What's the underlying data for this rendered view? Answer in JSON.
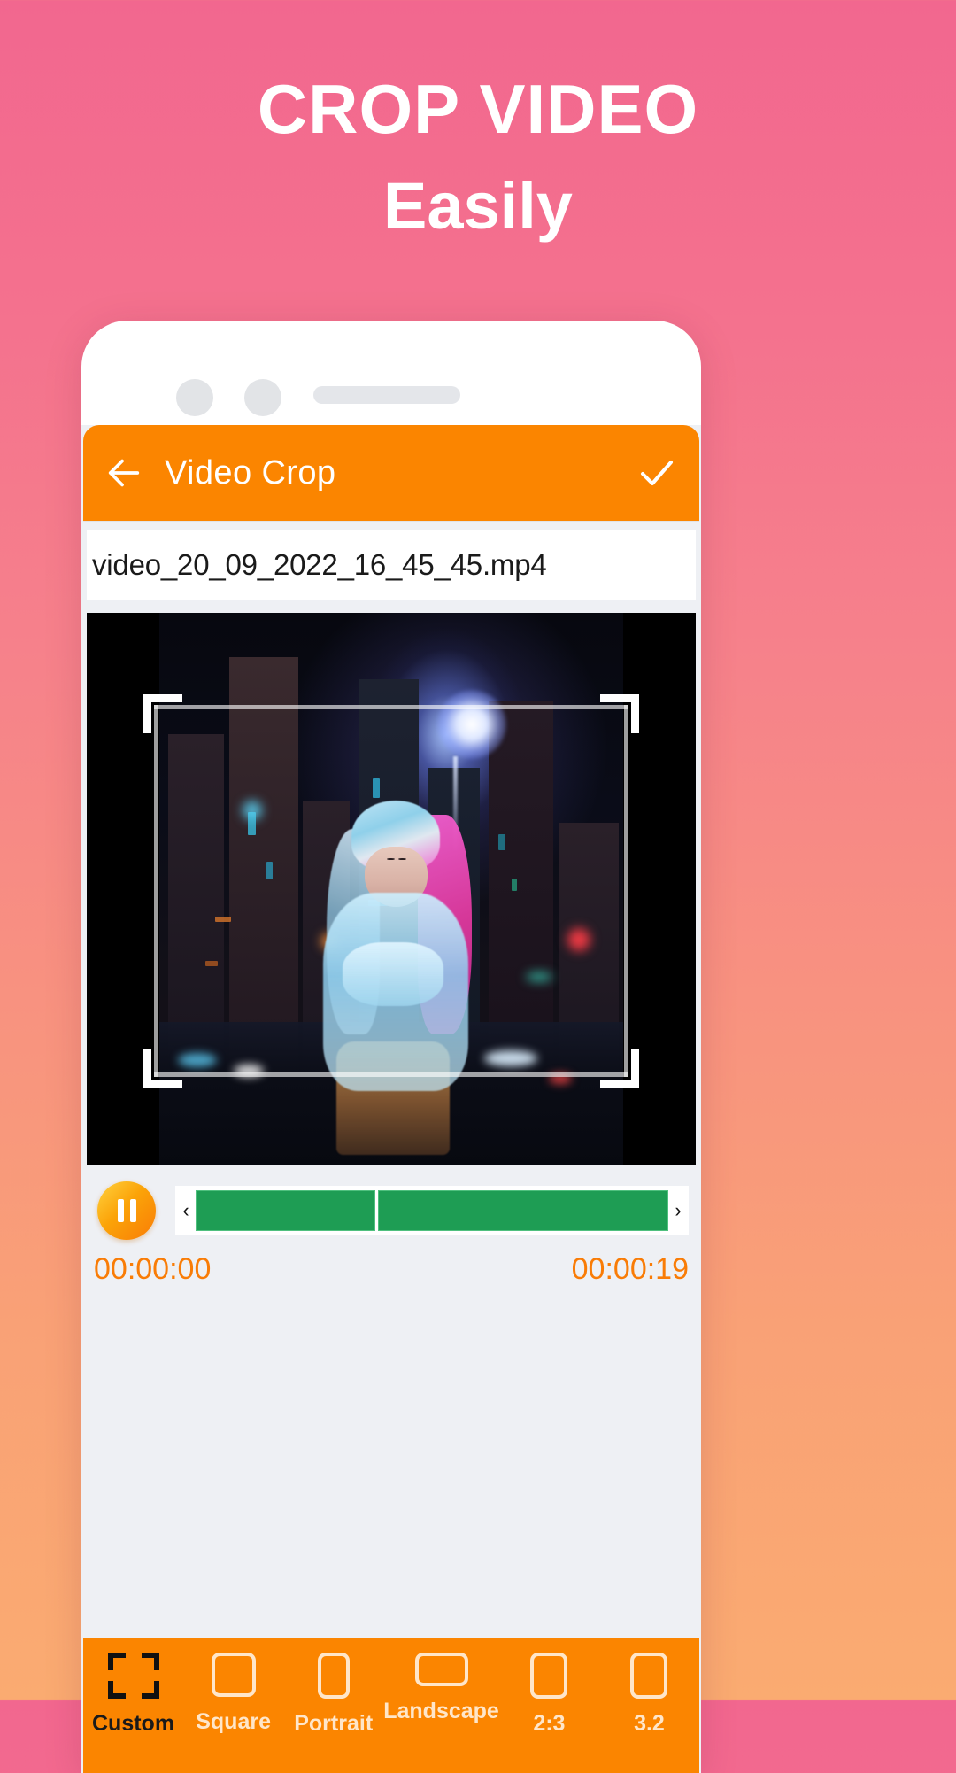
{
  "promo": {
    "title": "CROP VIDEO",
    "subtitle": "Easily"
  },
  "colors": {
    "accent_orange": "#FB8500",
    "timeline_green": "#1E9D54",
    "time_text": "#F97C06",
    "background_pink": "#F2678F",
    "background_peach": "#FAAB71"
  },
  "appbar": {
    "back_icon": "arrow-left-icon",
    "title": "Video Crop",
    "done_icon": "check-icon"
  },
  "file": {
    "name": "video_20_09_2022_16_45_45.mp4"
  },
  "player": {
    "play_state_icon": "pause-icon",
    "prev_arrow": "‹",
    "next_arrow": "›",
    "current_time": "00:00:00",
    "total_time": "00:00:19"
  },
  "crop": {
    "handles": [
      "top-left",
      "top-right",
      "bottom-left",
      "bottom-right"
    ]
  },
  "aspect_bar": {
    "items": [
      {
        "label": "Custom",
        "icon": "crop-corners-icon",
        "selected": true
      },
      {
        "label": "Square",
        "icon": "square-icon",
        "selected": false
      },
      {
        "label": "Portrait",
        "icon": "portrait-icon",
        "selected": false
      },
      {
        "label": "Landscape",
        "icon": "landscape-icon",
        "selected": false
      },
      {
        "label": "2:3",
        "icon": "ratio-2-3-icon",
        "selected": false
      },
      {
        "label": "3.2",
        "icon": "ratio-3-2-icon",
        "selected": false
      }
    ]
  }
}
